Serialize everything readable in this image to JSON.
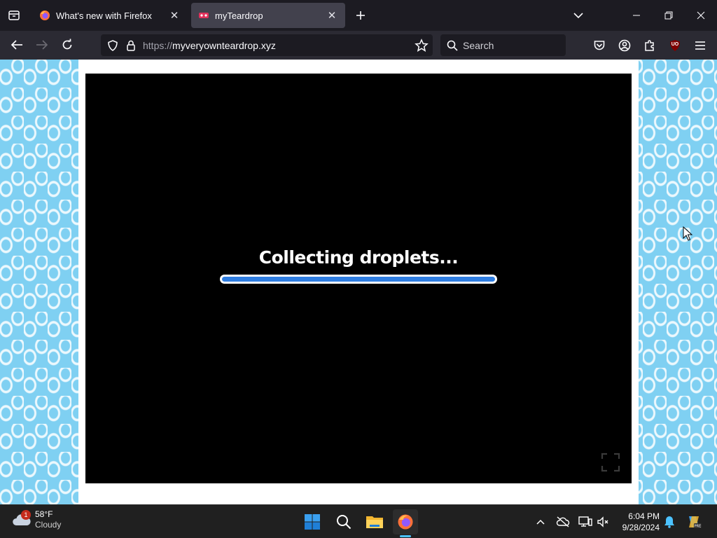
{
  "browser": {
    "tabs": [
      {
        "title": "What's new with Firefox",
        "active": false
      },
      {
        "title": "myTeardrop",
        "active": true
      }
    ],
    "url_scheme": "https://",
    "url_host": "myveryownteardrop.xyz",
    "search_placeholder": "Search",
    "ublock_label": "UO"
  },
  "page": {
    "loading_text": "Collecting droplets...",
    "progress": 1.0,
    "accent_color": "#2e7de1"
  },
  "taskbar": {
    "weather": {
      "temp": "58°F",
      "condition": "Cloudy",
      "badge": "1"
    },
    "clock": {
      "time": "6:04 PM",
      "date": "9/28/2024"
    }
  }
}
